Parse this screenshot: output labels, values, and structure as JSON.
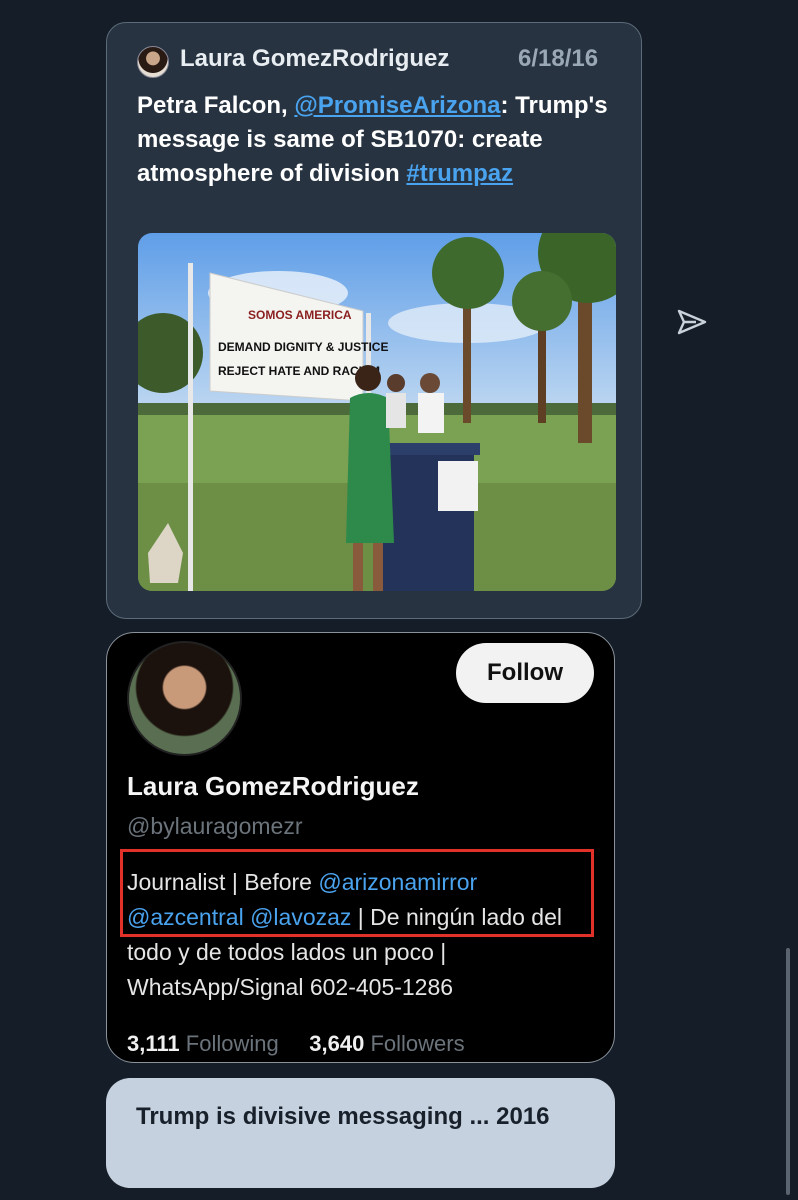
{
  "tweet": {
    "author": "Laura GomezRodriguez",
    "date": "6/18/16",
    "text_prefix": "Petra Falcon, ",
    "mention": "@PromiseArizona",
    "text_middle": ": Trump's message is same of SB1070: create atmosphere of division ",
    "hashtag": "#trumpaz",
    "photo": {
      "banner_line1": "SOMOS AMERICA",
      "banner_line2": "DEMAND DIGNITY & JUSTICE",
      "banner_line3": "REJECT HATE AND RACISM"
    }
  },
  "profile": {
    "name": "Laura GomezRodriguez",
    "handle": "@bylauragomezr",
    "follow_label": "Follow",
    "bio": {
      "t1": "Journalist | Before ",
      "m1": "@arizonamirror",
      "m2": "@azcentral",
      "m3": "@lavozaz",
      "t2": " | De ningún lado del todo y de todos lados un poco | WhatsApp/Signal 602-405-1286"
    },
    "following_count": "3,111",
    "following_label": "Following",
    "followers_count": "3,640",
    "followers_label": "Followers"
  },
  "reply": {
    "text": "Trump is divisive messaging ... 2016"
  },
  "colors": {
    "background": "#151d28",
    "link": "#4aa3ee",
    "highlight": "#e23128"
  }
}
